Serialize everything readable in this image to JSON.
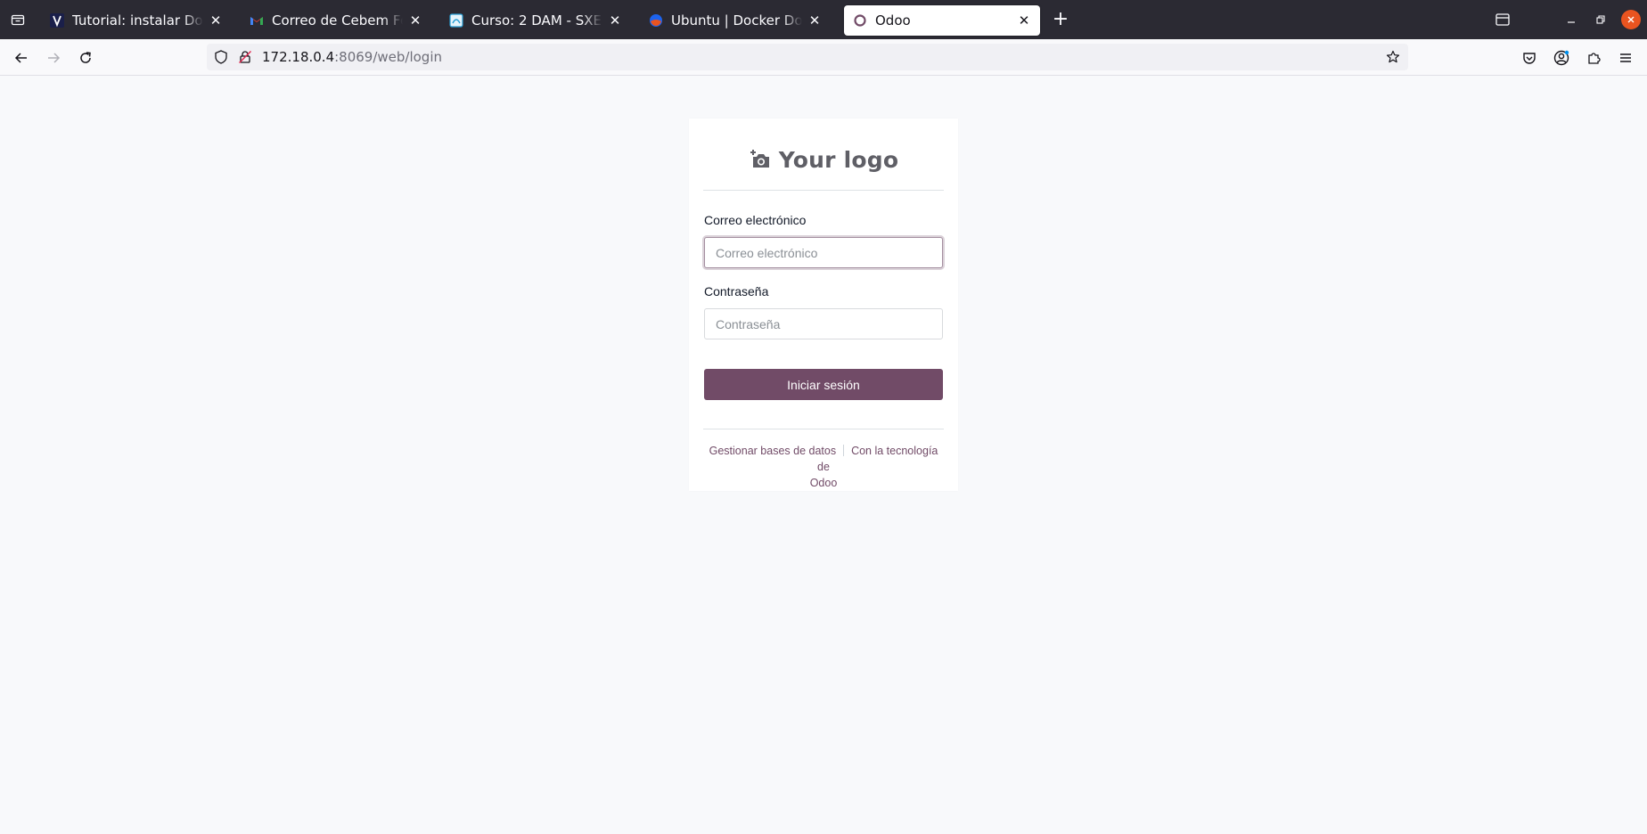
{
  "browser": {
    "tabs": [
      {
        "title": "Tutorial: instalar Docker C",
        "favicon": "vlogo-icon",
        "active": false
      },
      {
        "title": "Correo de Cebem Formaci",
        "favicon": "gmail-icon",
        "active": false
      },
      {
        "title": "Curso: 2 DAM - SXE (Sistem",
        "favicon": "moodle-icon",
        "active": false
      },
      {
        "title": "Ubuntu | Docker Docs",
        "favicon": "docker-icon",
        "active": false
      },
      {
        "title": "Odoo",
        "favicon": "odoo-icon",
        "active": true
      }
    ],
    "url": {
      "host": "172.18.0.4",
      "rest": ":8069/web/login"
    },
    "colors": {
      "tabstrip_bg": "#2b2a33",
      "toolbar_bg": "#f9f9fb",
      "window_close": "#e95420"
    }
  },
  "page": {
    "logo_text": "Your logo",
    "email": {
      "label": "Correo electrónico",
      "placeholder": "Correo electrónico",
      "value": ""
    },
    "password": {
      "label": "Contraseña",
      "placeholder": "Contraseña",
      "value": ""
    },
    "login_button": "Iniciar sesión",
    "footer": {
      "manage_db": "Gestionar bases de datos",
      "powered_by": "Con la tecnología de",
      "powered_by_brand": "Odoo"
    },
    "colors": {
      "primary": "#714b67",
      "background": "#f8f9fb"
    }
  }
}
